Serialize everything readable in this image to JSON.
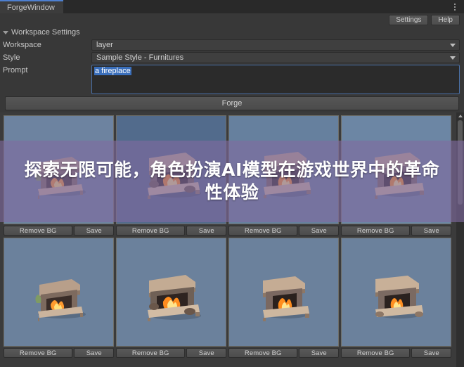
{
  "window": {
    "tab_label": "ForgeWindow",
    "menu_icon": "kebab-menu-icon"
  },
  "header": {
    "settings_label": "Settings",
    "help_label": "Help"
  },
  "settings_panel": {
    "foldout_label": "Workspace Settings",
    "foldout_icon": "triangle-down-icon",
    "fields": {
      "workspace_label": "Workspace",
      "workspace_value": "layer",
      "style_label": "Style",
      "style_value": "Sample Style - Furnitures",
      "prompt_label": "Prompt",
      "prompt_value": "a fireplace"
    },
    "dropdown_icon": "chevron-down-icon"
  },
  "forge": {
    "button_label": "Forge"
  },
  "results": {
    "remove_bg_label": "Remove BG",
    "save_label": "Save",
    "rows": [
      {
        "cells": [
          {
            "alt": "generated-fireplace-1"
          },
          {
            "alt": "generated-fireplace-2"
          },
          {
            "alt": "generated-fireplace-3"
          },
          {
            "alt": "generated-fireplace-4"
          }
        ]
      },
      {
        "cells": [
          {
            "alt": "generated-fireplace-5"
          },
          {
            "alt": "generated-fireplace-6"
          },
          {
            "alt": "generated-fireplace-7"
          },
          {
            "alt": "generated-fireplace-8"
          }
        ]
      }
    ]
  },
  "scrollbar": {
    "up_icon": "scroll-up-arrow-icon",
    "down_icon": "scroll-down-arrow-icon"
  },
  "overlay": {
    "text": "探索无限可能，角色扮演AI模型在游戏世界中的革命性体验",
    "color": "#806aa0"
  },
  "colors": {
    "window_bg": "#383838",
    "panel_bg": "#3b3b3b",
    "tab_active_accent": "#4d7fd0",
    "selection_blue": "#3a6fbc",
    "thumb_bg": "#6d83a0"
  }
}
